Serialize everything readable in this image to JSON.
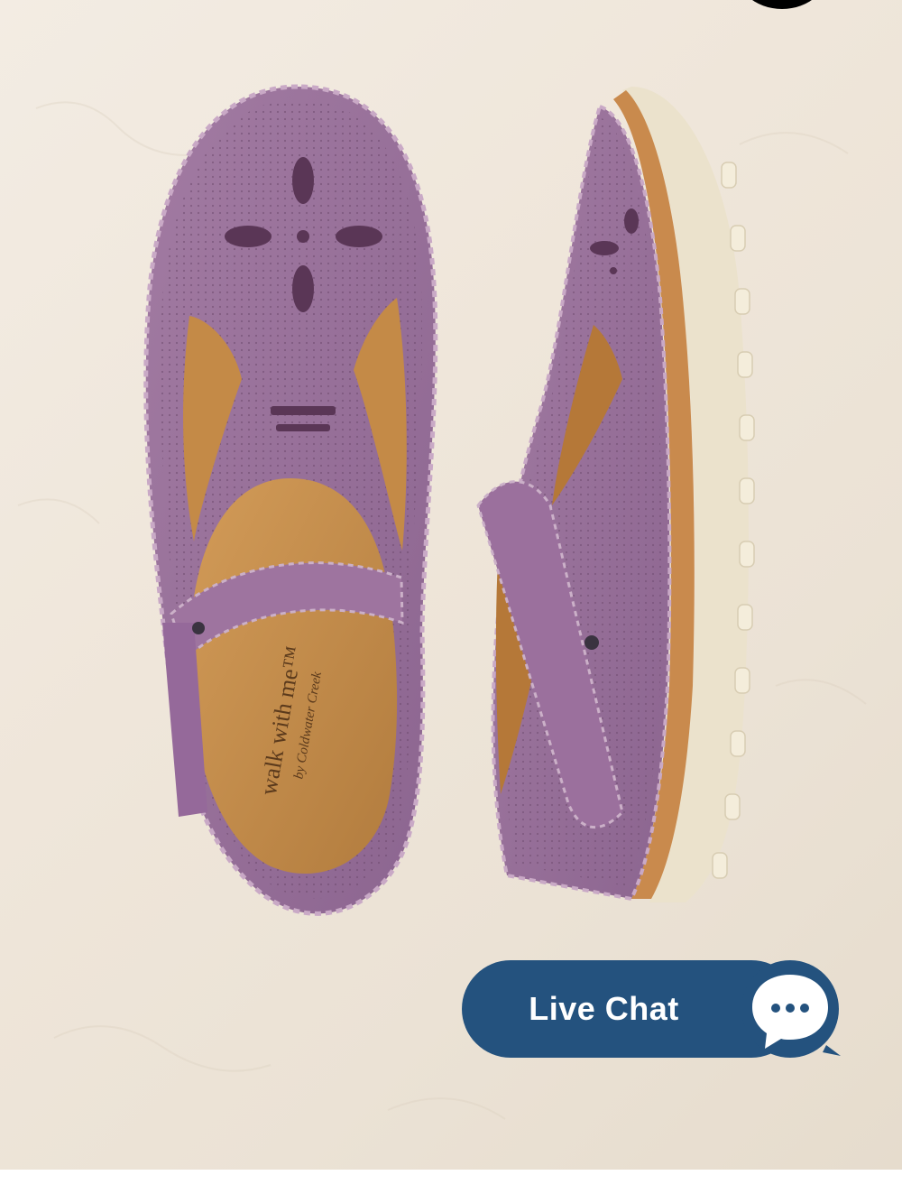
{
  "product_image": {
    "alt": "",
    "insole_brand_text": "walk with me™",
    "insole_brand_subtext": "by Coldwater Creek"
  },
  "live_chat": {
    "label": "Live Chat",
    "icon": "chat-bubble-icon",
    "color": "#24527e"
  },
  "colors": {
    "shoe_leather": "#9a7099",
    "insole": "#c08a4a",
    "sole": "#eee5cf",
    "background": "#efe6da"
  }
}
